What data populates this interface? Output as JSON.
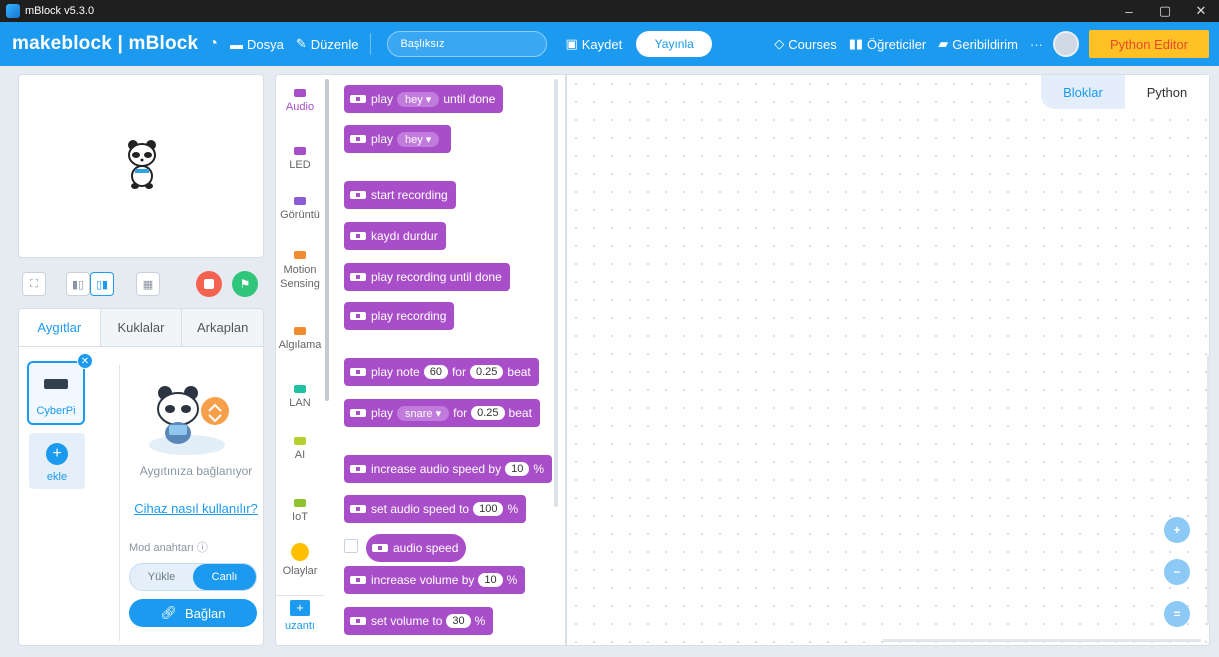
{
  "window": {
    "title": "mBlock v5.3.0",
    "min": "–",
    "restore": "▢",
    "close": "✕"
  },
  "menubar": {
    "brand": "makeblock | mBlock",
    "file": "Dosya",
    "edit": "Düzenle",
    "project_title": "Başlıksız",
    "save": "Kaydet",
    "publish": "Yayınla",
    "courses": "Courses",
    "tutorials": "Öğreticiler",
    "feedback": "Geribildirim",
    "more": "···",
    "python_editor": "Python Editor"
  },
  "devices_panel": {
    "tabs": [
      "Aygıtlar",
      "Kuklalar",
      "Arkaplan"
    ],
    "active_tab": "Aygıtlar",
    "device_name": "CyberPi",
    "add_label": "ekle",
    "connecting_text": "Aygıtınıza bağlanıyor",
    "howto_link": "Cihaz nasıl kullanılır?",
    "mode_label": "Mod anahtarı ⓘ",
    "mode_upload": "Yükle",
    "mode_live": "Canlı",
    "connect_button": "Bağlan"
  },
  "categories": [
    {
      "label": "Audio",
      "color": "#a94ec9",
      "active": true
    },
    {
      "label": "LED",
      "color": "#a94ec9"
    },
    {
      "label": "Görüntü",
      "color": "#8c5bd6"
    },
    {
      "label": "Motion Sensing",
      "color": "#f08c2e"
    },
    {
      "label": "Algılama",
      "color": "#f08c2e"
    },
    {
      "label": "LAN",
      "color": "#1fc3a4"
    },
    {
      "label": "AI",
      "color": "#b5cf2c"
    },
    {
      "label": "IoT",
      "color": "#8fc32e"
    },
    {
      "label": "Olaylar",
      "color": "#ffbf00"
    },
    {
      "label": "uzantı",
      "color": "#1b9af0"
    }
  ],
  "blocks": {
    "play_until_done": {
      "pre": "play",
      "sound": "hey ▾",
      "post": "until done"
    },
    "play": {
      "pre": "play",
      "sound": "hey ▾"
    },
    "start_recording": "start recording",
    "stop_recording": "kaydı durdur",
    "play_recording_until_done": "play recording until done",
    "play_recording": "play recording",
    "play_note": {
      "pre": "play note",
      "note": "60",
      "mid": "for",
      "beats": "0.25",
      "post": "beat"
    },
    "play_drum": {
      "pre": "play",
      "drum": "snare ▾",
      "mid": "for",
      "beats": "0.25",
      "post": "beat"
    },
    "increase_speed": {
      "pre": "increase audio speed by",
      "value": "10",
      "post": "%"
    },
    "set_speed": {
      "pre": "set audio speed to",
      "value": "100",
      "post": "%"
    },
    "audio_speed": "audio speed",
    "increase_volume": {
      "pre": "increase volume by",
      "value": "10",
      "post": "%"
    },
    "set_volume": {
      "pre": "set volume to",
      "value": "30",
      "post": "%"
    }
  },
  "code_area": {
    "tabs": [
      "Bloklar",
      "Python"
    ],
    "active_tab": "Bloklar"
  },
  "colors": {
    "brand_blue": "#1b9af0",
    "audio_purple": "#a94ec9",
    "python_yellow": "#ffc124"
  }
}
